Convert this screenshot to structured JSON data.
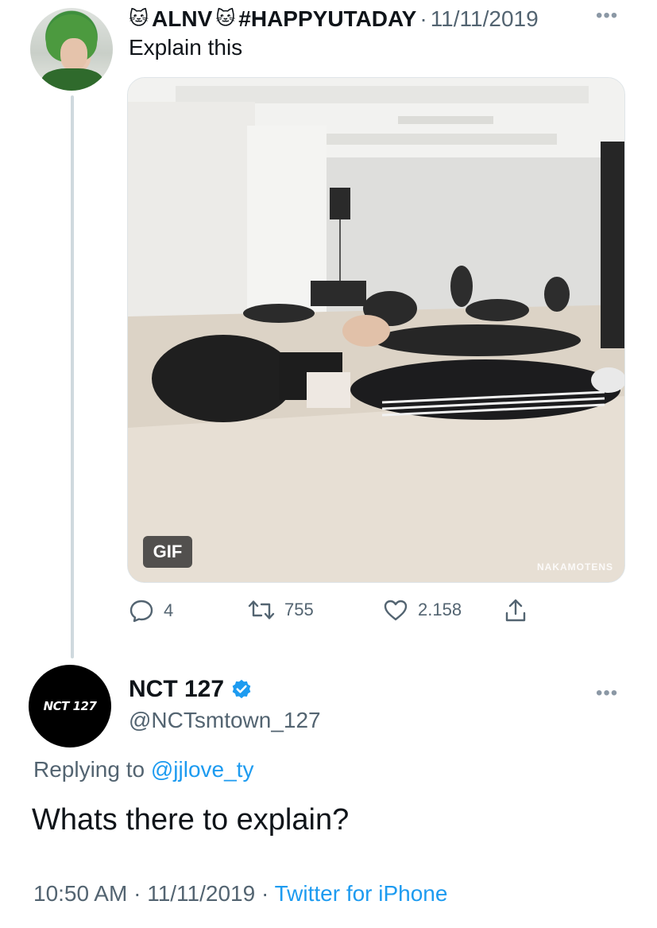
{
  "tweet": {
    "author_name": "ALNV",
    "name_emoji": "🐱",
    "hashtag": "#HAPPYUTADAY",
    "separator": "·",
    "date": "11/11/2019",
    "more": "•••",
    "text": "Explain this",
    "media": {
      "badge": "GIF",
      "watermark": "NAKAMOTENS"
    },
    "stats": {
      "replies": "4",
      "retweets": "755",
      "likes": "2.158"
    }
  },
  "reply": {
    "avatar_text": "NCT 127",
    "display_name": "NCT 127",
    "handle": "@NCTsmtown_127",
    "more": "•••",
    "replying_prefix": "Replying to",
    "replying_mention": "@jjlove_ty",
    "text": "Whats there to explain?",
    "time": "10:50 AM",
    "date": "11/11/2019",
    "separator": "·",
    "source": "Twitter for iPhone"
  },
  "colors": {
    "link": "#1d9bf0",
    "secondary_text": "#536471",
    "primary_text": "#0f1419",
    "verified": "#1d9bf0"
  },
  "icons": [
    "reply-icon",
    "retweet-icon",
    "like-icon",
    "share-icon",
    "verified-badge-icon",
    "more-icon"
  ]
}
